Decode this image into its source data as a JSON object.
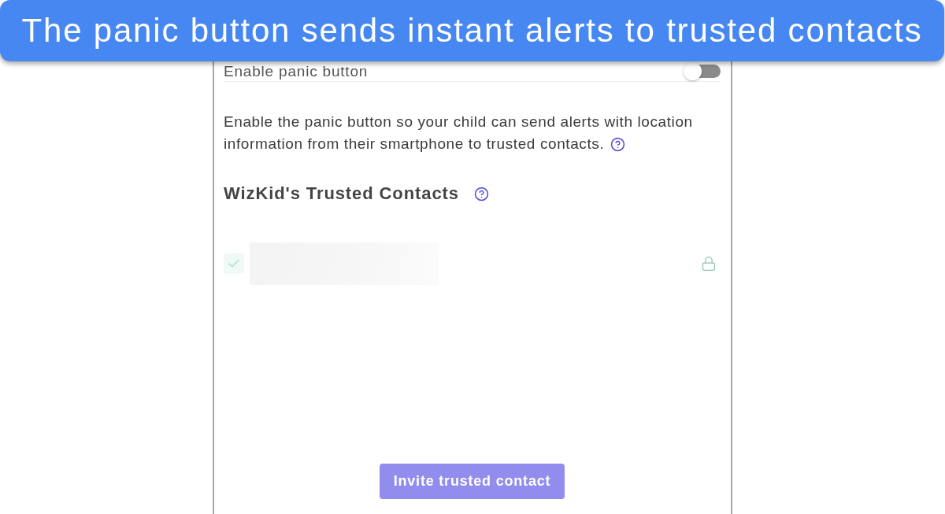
{
  "caption": "The panic button sends instant alerts to trusted contacts",
  "panic_toggle": {
    "label": "Enable panic button",
    "on": false
  },
  "description_lines": [
    "Enable the panic button so your child can send alerts with location",
    "information from their smartphone to trusted contacts."
  ],
  "trusted_contacts": {
    "title": "WizKid's Trusted Contacts",
    "contacts": [
      {
        "checked": true,
        "locked": true
      }
    ]
  },
  "invite_button": {
    "label": "Invite trusted contact",
    "disabled": true
  }
}
